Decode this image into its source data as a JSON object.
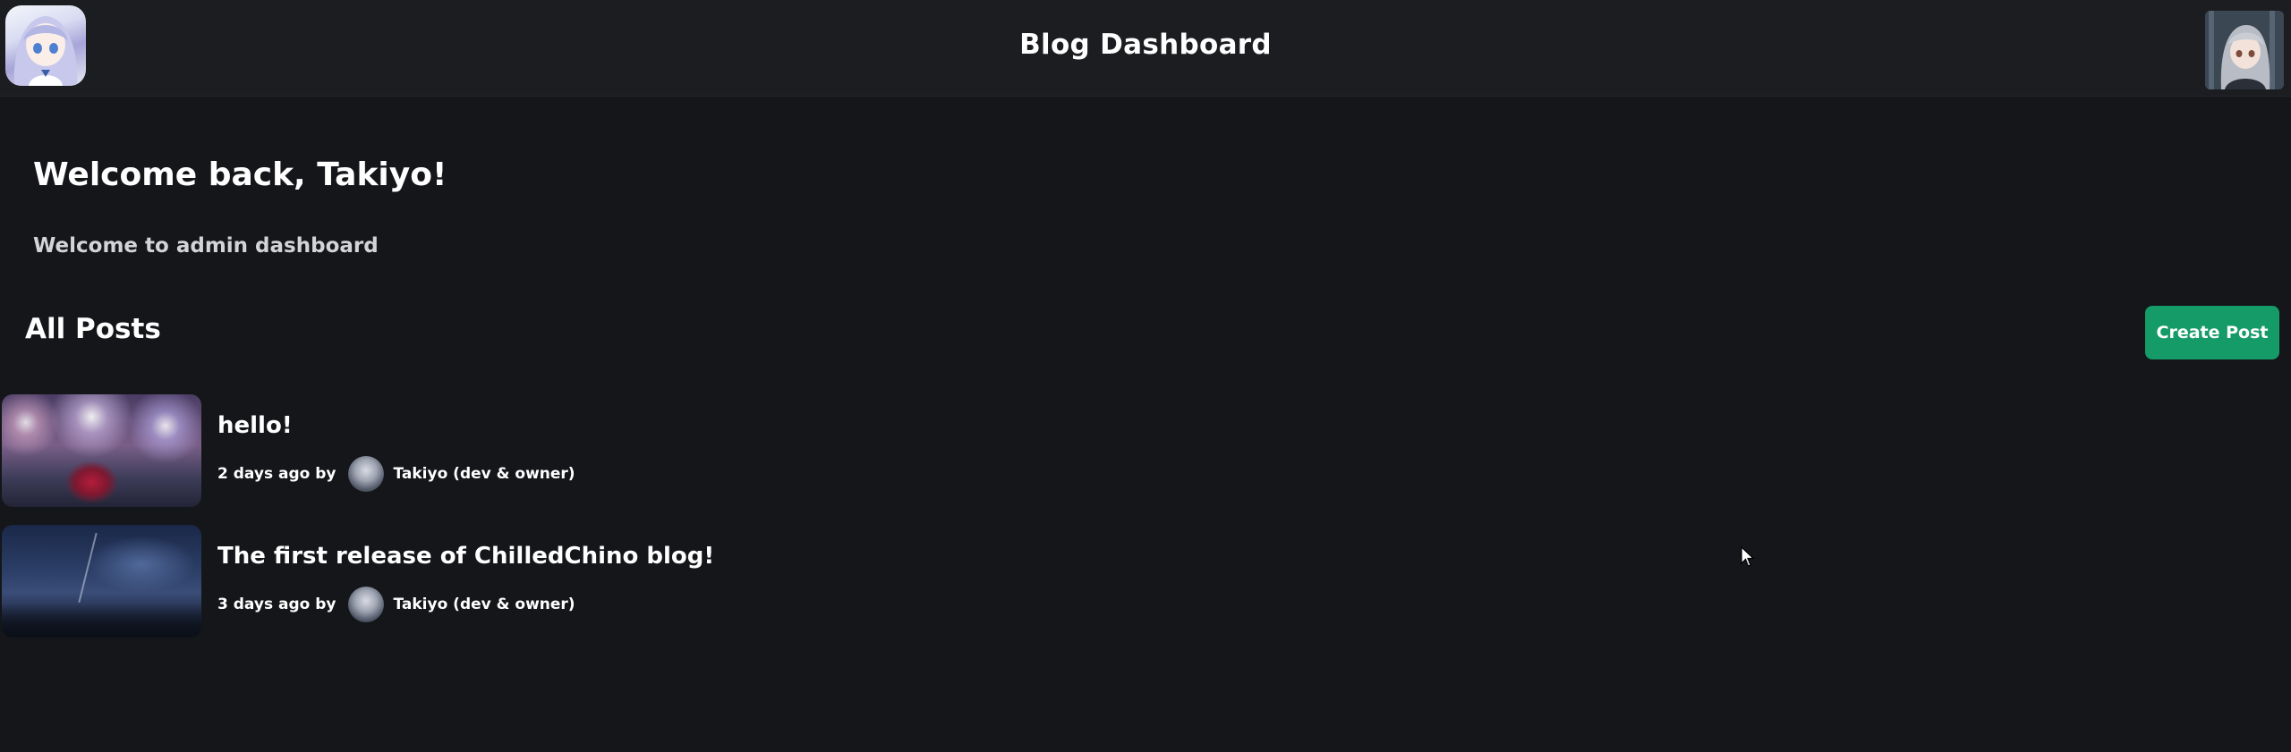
{
  "header": {
    "title": "Blog Dashboard",
    "logo_icon": "anime-girl-logo-icon",
    "user_avatar_icon": "user-avatar-icon"
  },
  "welcome": {
    "title": "Welcome back, Takiyo!",
    "subtitle": "Welcome to admin dashboard"
  },
  "posts": {
    "heading": "All Posts",
    "create_label": "Create Post",
    "items": [
      {
        "title": "hello!",
        "time": "2 days ago by",
        "author": "Takiyo (dev & owner)",
        "thumbnail": "fireworks-thumbnail"
      },
      {
        "title": "The first release of ChilledChino blog!",
        "time": "3 days ago by",
        "author": "Takiyo (dev & owner)",
        "thumbnail": "night-sky-thumbnail"
      }
    ]
  },
  "colors": {
    "background": "#141619",
    "header_bg": "#1b1d21",
    "accent": "#149b68"
  }
}
